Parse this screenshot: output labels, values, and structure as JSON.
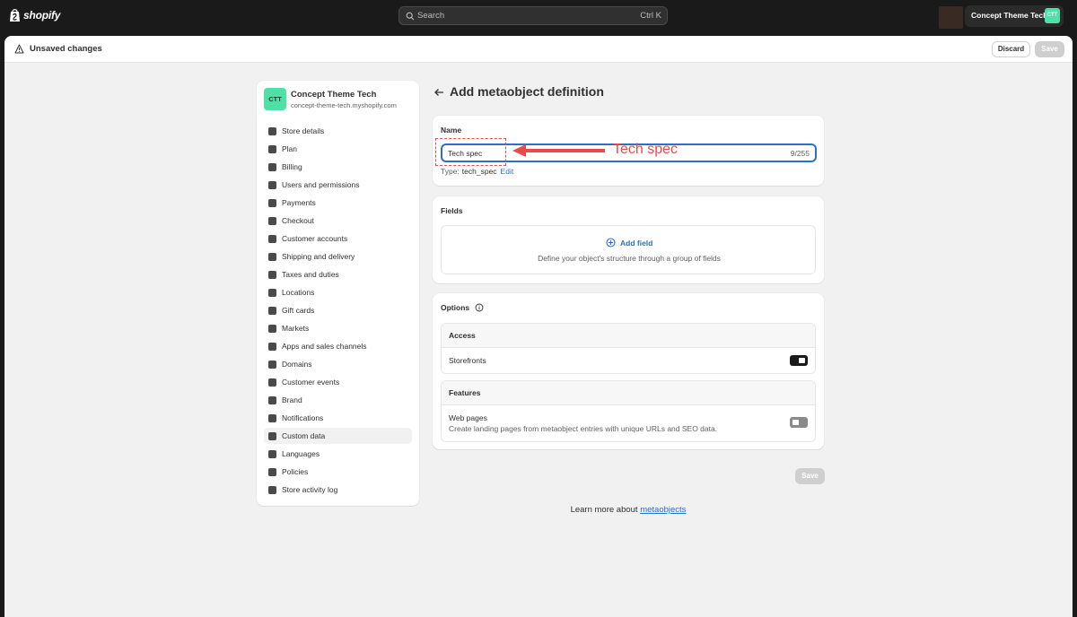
{
  "topbar": {
    "brand": "shopify",
    "search_placeholder": "Search",
    "search_shortcut": "Ctrl K",
    "store_name": "Concept Theme Tech",
    "store_avatar": "CTT"
  },
  "unsaved_bar": {
    "message": "Unsaved changes",
    "discard_label": "Discard",
    "save_label": "Save"
  },
  "sidebar": {
    "store_name": "Concept Theme Tech",
    "store_domain": "concept-theme-tech.myshopify.com",
    "avatar": "CTT",
    "items": [
      {
        "label": "Store details",
        "icon": "store-icon"
      },
      {
        "label": "Plan",
        "icon": "plan-icon"
      },
      {
        "label": "Billing",
        "icon": "billing-icon"
      },
      {
        "label": "Users and permissions",
        "icon": "users-icon"
      },
      {
        "label": "Payments",
        "icon": "payments-icon"
      },
      {
        "label": "Checkout",
        "icon": "cart-icon"
      },
      {
        "label": "Customer accounts",
        "icon": "person-icon"
      },
      {
        "label": "Shipping and delivery",
        "icon": "truck-icon"
      },
      {
        "label": "Taxes and duties",
        "icon": "tax-icon"
      },
      {
        "label": "Locations",
        "icon": "location-icon"
      },
      {
        "label": "Gift cards",
        "icon": "gift-icon"
      },
      {
        "label": "Markets",
        "icon": "globe-icon"
      },
      {
        "label": "Apps and sales channels",
        "icon": "apps-icon"
      },
      {
        "label": "Domains",
        "icon": "domain-icon"
      },
      {
        "label": "Customer events",
        "icon": "events-icon"
      },
      {
        "label": "Brand",
        "icon": "brand-icon"
      },
      {
        "label": "Notifications",
        "icon": "bell-icon"
      },
      {
        "label": "Custom data",
        "icon": "database-icon"
      },
      {
        "label": "Languages",
        "icon": "language-icon"
      },
      {
        "label": "Policies",
        "icon": "policy-icon"
      },
      {
        "label": "Store activity log",
        "icon": "activity-icon"
      }
    ],
    "active_item": "Custom data"
  },
  "page": {
    "title": "Add metaobject definition"
  },
  "name_card": {
    "label": "Name",
    "value": "Tech spec",
    "counter": "9/255",
    "type_prefix": "Type:",
    "type_value": "tech_spec",
    "edit_label": "Edit"
  },
  "fields_card": {
    "label": "Fields",
    "add_label": "Add field",
    "description": "Define your object's structure through a group of fields"
  },
  "options_card": {
    "label": "Options",
    "access": {
      "heading": "Access",
      "row_label": "Storefronts",
      "enabled": true
    },
    "features": {
      "heading": "Features",
      "row_label": "Web pages",
      "row_desc": "Create landing pages from metaobject entries with unique URLs and SEO data.",
      "enabled": false
    }
  },
  "bottom": {
    "save_label": "Save",
    "learn_prefix": "Learn more about",
    "learn_link": "metaobjects"
  },
  "annotation": {
    "text": "Tech spec",
    "color": "#e84a4a"
  }
}
